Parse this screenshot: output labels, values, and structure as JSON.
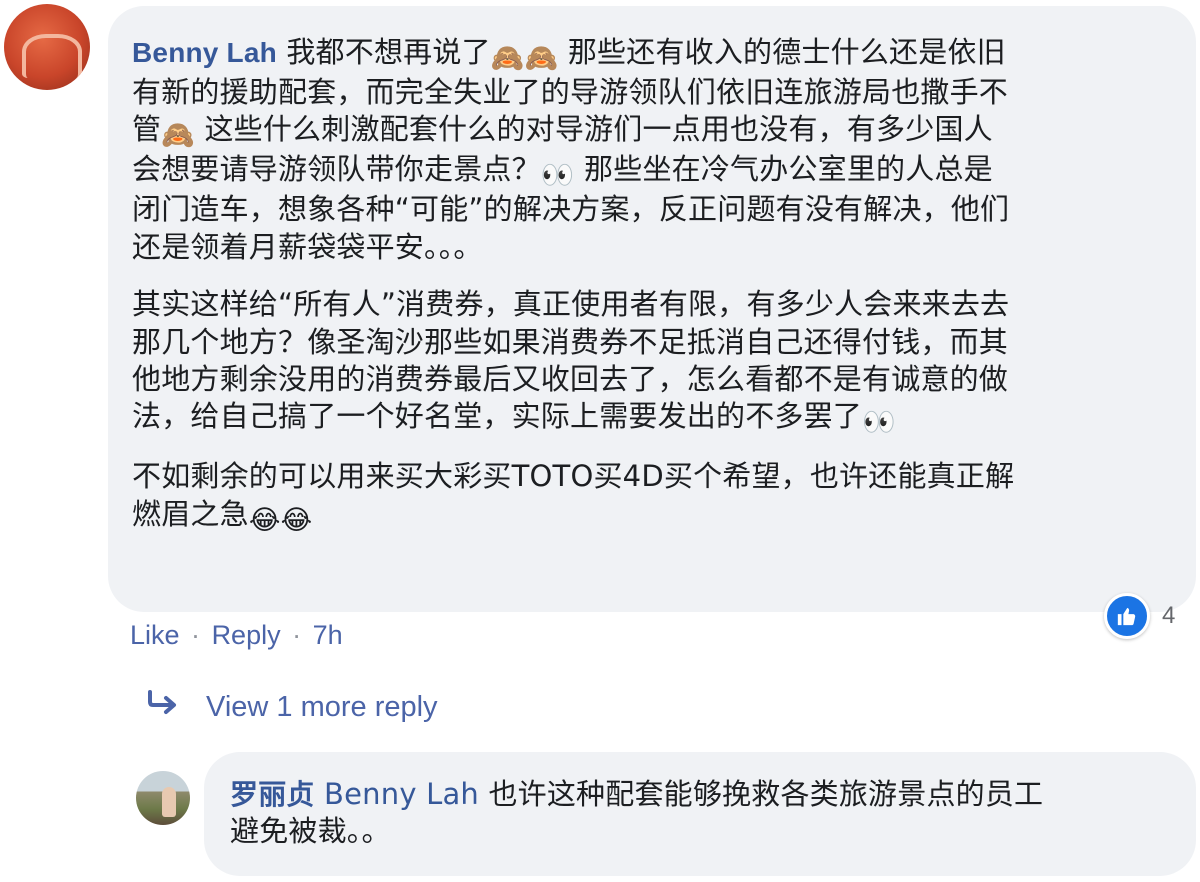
{
  "comment": {
    "author": "Benny Lah",
    "avatar": "orange-shirt-avatar",
    "paragraphs": [
      {
        "parts": [
          "我都不想再说了",
          "🙈",
          "🙈",
          " 那些还有收入的德士什么还是依旧\n有新的援助配套，而完全失业了的导游领队们依旧连旅游局也撒手不\n管",
          "🙈",
          " 这些什么刺激配套什么的对导游们一点用也没有，有多少国人\n会想要请导游领队带你走景点？",
          "👀",
          " 那些坐在冷气办公室里的人总是\n闭门造车，想象各种“可能”的解决方案，反正问题有没有解决，他们\n还是领着月薪袋袋平安。。。"
        ]
      },
      {
        "parts": [
          "其实这样给“所有人”消费券，真正使用者有限，有多少人会来来去去\n那几个地方？像圣淘沙那些如果消费券不足抵消自己还得付钱，而其\n他地方剩余没用的消费券最后又收回去了，怎么看都不是有诚意的做\n法，给自己搞了一个好名堂，实际上需要发出的不多罢了",
          "👀"
        ]
      },
      {
        "parts": [
          "不如剩余的可以用来买大彩买TOTO买4D买个希望，也许还能真正解\n燃眉之急",
          "😂",
          "😂"
        ]
      }
    ],
    "actions": {
      "like": "Like",
      "separator": "·",
      "reply": "Reply",
      "time": "7h"
    },
    "reactions": {
      "icon": "thumbs-up-icon",
      "count": "4",
      "color": "#1b74e4"
    }
  },
  "view_more": {
    "icon": "reply-arrow-icon",
    "label": "View 1 more reply"
  },
  "reply": {
    "author": "罗丽贞",
    "mention": "Benny Lah",
    "text": " 也许这种配套能够挽救各类旅游景点的员工\n避免被裁。。",
    "avatar": "landscape-avatar"
  },
  "colors": {
    "link": "#365899",
    "meta": "#65676b",
    "bubble": "#f0f2f5"
  }
}
